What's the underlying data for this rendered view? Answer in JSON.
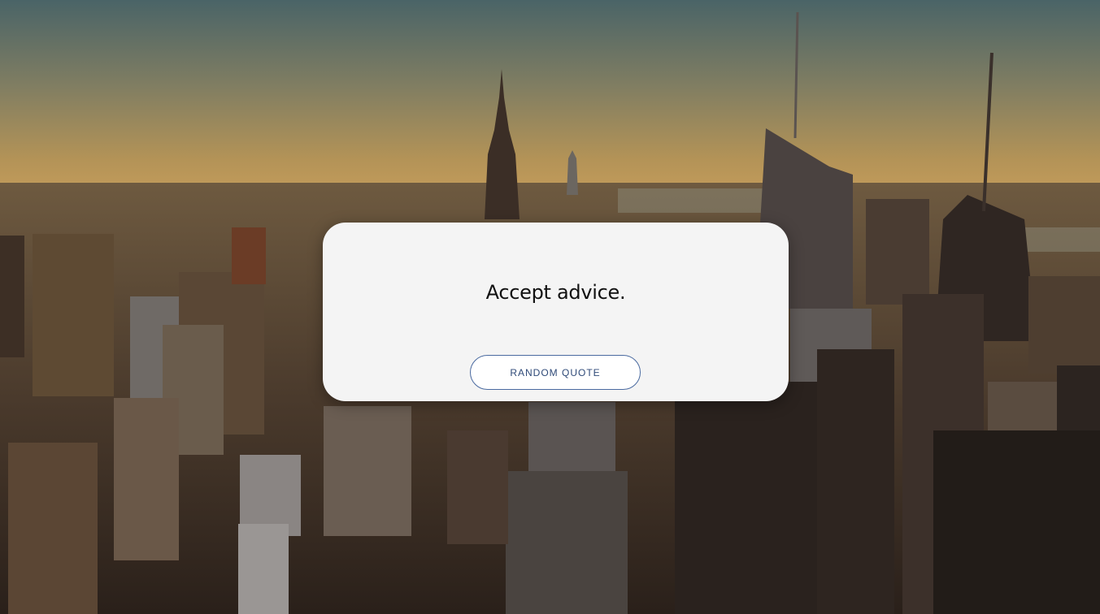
{
  "background": {
    "description_icon": "city-skyline-photo"
  },
  "quote_card": {
    "quote": "Accept advice.",
    "button_label": "RANDOM QUOTE"
  },
  "colors": {
    "card_background": "#f4f4f4",
    "button_border": "#4a6aa0",
    "button_text": "#2f4a78",
    "quote_text": "#111111"
  }
}
